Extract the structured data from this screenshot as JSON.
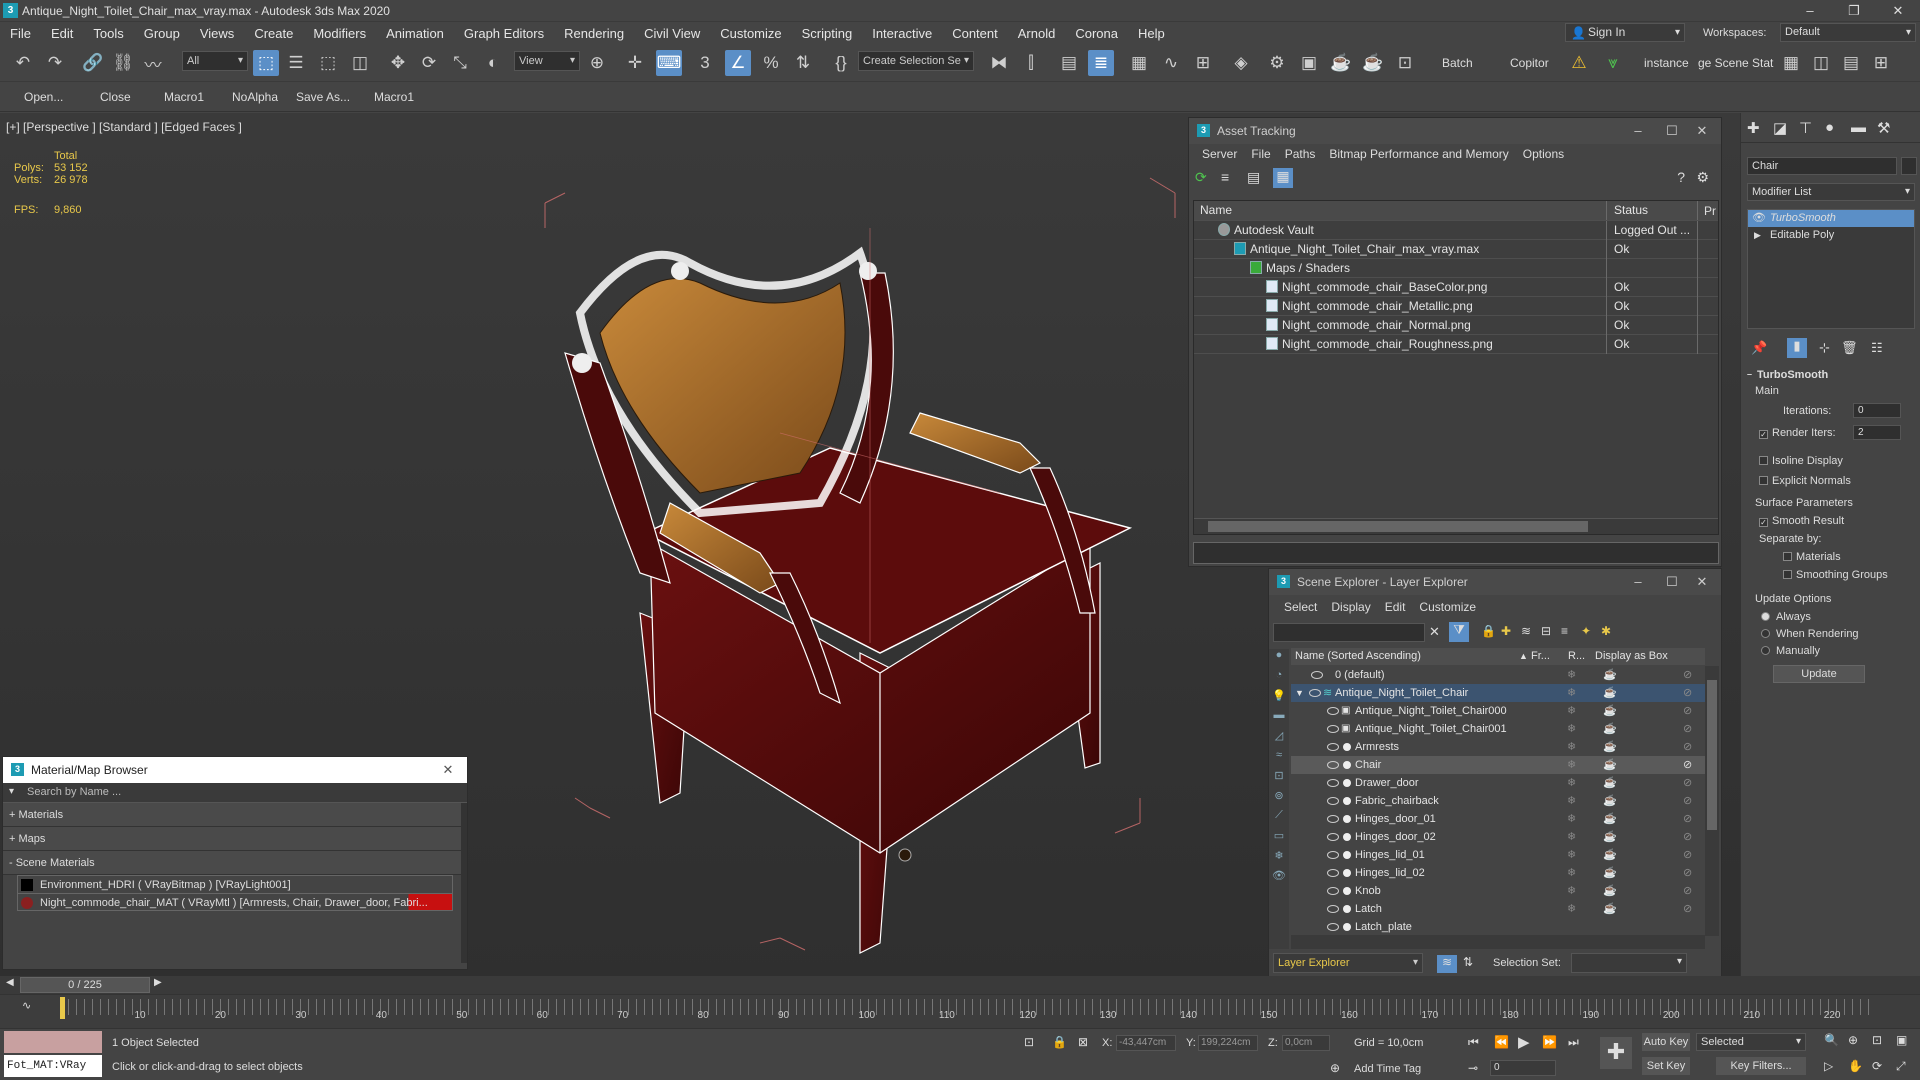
{
  "window": {
    "title": "Antique_Night_Toilet_Chair_max_vray.max - Autodesk 3ds Max 2020",
    "app_icon": "3"
  },
  "menu": [
    "File",
    "Edit",
    "Tools",
    "Group",
    "Views",
    "Create",
    "Modifiers",
    "Animation",
    "Graph Editors",
    "Rendering",
    "Civil View",
    "Customize",
    "Scripting",
    "Interactive",
    "Content",
    "Arnold",
    "Corona",
    "Help"
  ],
  "account": {
    "sign_in": "Sign In",
    "workspaces_label": "Workspaces:",
    "workspace": "Default"
  },
  "toolbar": {
    "filter": "All",
    "view": "View",
    "selection_set": "Create Selection Se",
    "batch": "Batch",
    "copitor": "Copitor",
    "instance": "instance",
    "scene_stat": "ge Scene Stat"
  },
  "macros": [
    "Open...",
    "Close",
    "Macro1",
    "NoAlpha",
    "Save As...",
    "Macro1"
  ],
  "viewport": {
    "label": "[+] [Perspective ] [Standard ] [Edged Faces ]",
    "total_label": "Total",
    "polys_label": "Polys:",
    "polys": "53 152",
    "verts_label": "Verts:",
    "verts": "26 978",
    "fps_label": "FPS:",
    "fps": "9,860"
  },
  "asset_tracking": {
    "title": "Asset Tracking",
    "menu": [
      "Server",
      "File",
      "Paths",
      "Bitmap Performance and Memory",
      "Options"
    ],
    "columns": [
      "Name",
      "Status",
      "Pr"
    ],
    "rows": [
      {
        "name": "Autodesk Vault",
        "status": "Logged Out ..."
      },
      {
        "name": "Antique_Night_Toilet_Chair_max_vray.max",
        "status": "Ok"
      },
      {
        "name": "Maps / Shaders",
        "status": ""
      },
      {
        "name": "Night_commode_chair_BaseColor.png",
        "status": "Ok"
      },
      {
        "name": "Night_commode_chair_Metallic.png",
        "status": "Ok"
      },
      {
        "name": "Night_commode_chair_Normal.png",
        "status": "Ok"
      },
      {
        "name": "Night_commode_chair_Roughness.png",
        "status": "Ok"
      }
    ]
  },
  "scene_explorer": {
    "title": "Scene Explorer - Layer Explorer",
    "menu": [
      "Select",
      "Display",
      "Edit",
      "Customize"
    ],
    "columns": {
      "name": "Name (Sorted Ascending)",
      "frozen": "Fr...",
      "render": "R...",
      "box": "Display as Box"
    },
    "rows": [
      "0 (default)",
      "Antique_Night_Toilet_Chair",
      "Antique_Night_Toilet_Chair000",
      "Antique_Night_Toilet_Chair001",
      "Armrests",
      "Chair",
      "Drawer_door",
      "Fabric_chairback",
      "Hinges_door_01",
      "Hinges_door_02",
      "Hinges_lid_01",
      "Hinges_lid_02",
      "Knob",
      "Latch",
      "Latch_plate"
    ],
    "footer_dropdown": "Layer Explorer",
    "selection_set_label": "Selection Set:"
  },
  "material_browser": {
    "title": "Material/Map Browser",
    "search_placeholder": "Search by Name ...",
    "groups": [
      "+ Materials",
      "+ Maps",
      "- Scene Materials"
    ],
    "items": [
      "Environment_HDRI ( VRayBitmap ) [VRayLight001]",
      "Night_commode_chair_MAT ( VRayMtl ) [Armrests, Chair, Drawer_door, Fabri..."
    ]
  },
  "command_panel": {
    "object_name": "Chair",
    "modifier_list": "Modifier List",
    "stack": [
      "TurboSmooth",
      "Editable Poly"
    ],
    "rollout_title": "TurboSmooth",
    "main": "Main",
    "iterations_label": "Iterations:",
    "iterations": "0",
    "render_iters_label": "Render Iters:",
    "render_iters": "2",
    "isoline": "Isoline Display",
    "explicit": "Explicit Normals",
    "surface_params": "Surface Parameters",
    "smooth_result": "Smooth Result",
    "separate_by": "Separate by:",
    "materials": "Materials",
    "smoothing_groups": "Smoothing Groups",
    "update_options": "Update Options",
    "always": "Always",
    "when_rendering": "When Rendering",
    "manually": "Manually",
    "update_btn": "Update"
  },
  "timeline": {
    "frame": "0 / 225",
    "ticks": [
      "10",
      "20",
      "30",
      "40",
      "50",
      "60",
      "70",
      "80",
      "90",
      "100",
      "110",
      "120",
      "130",
      "140",
      "150",
      "160",
      "170",
      "180",
      "190",
      "200",
      "210",
      "220"
    ]
  },
  "status": {
    "maxscript": "Fot_MAT:VRay",
    "selected": "1 Object Selected",
    "prompt": "Click or click-and-drag to select objects",
    "x_label": "X:",
    "x": "-43,447cm",
    "y_label": "Y:",
    "y": "199,224cm",
    "z_label": "Z:",
    "z": "0,0cm",
    "grid": "Grid = 10,0cm",
    "add_time_tag": "Add Time Tag",
    "auto_key": "Auto Key",
    "selected_dd": "Selected",
    "set_key": "Set Key",
    "key_filters": "Key Filters...",
    "frame_field": "0"
  }
}
